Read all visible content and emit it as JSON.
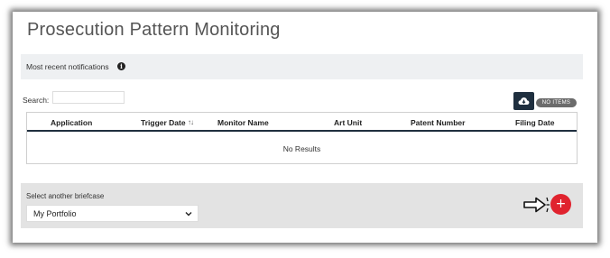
{
  "page": {
    "title": "Prosecution Pattern Monitoring"
  },
  "notifications": {
    "label": "Most recent notifications",
    "icon": "info-icon"
  },
  "search": {
    "label": "Search:",
    "value": "",
    "placeholder": ""
  },
  "toolbar": {
    "download_icon": "cloud-download-icon",
    "badge": "NO ITEMS"
  },
  "table": {
    "columns": [
      "Application",
      "Trigger Date",
      "Monitor Name",
      "Art Unit",
      "Patent Number",
      "Filing Date"
    ],
    "sort_indicator": "↑↓",
    "empty_text": "No Results"
  },
  "briefcase": {
    "label": "Select another briefcase",
    "selected": "My Portfolio"
  },
  "add_button": {
    "symbol": "+",
    "icon": "plus-icon"
  },
  "colors": {
    "accent_dark": "#1f2f3f",
    "add_red": "#e0232e",
    "badge_gray": "#6b6b6b",
    "panel_gray": "#e3e3e3",
    "notif_bg": "#eef0f2"
  }
}
